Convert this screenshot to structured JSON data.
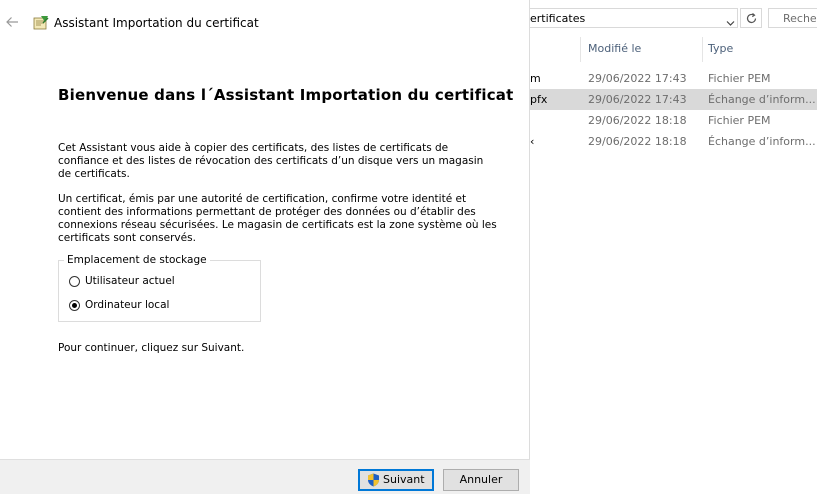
{
  "explorer": {
    "address_text": "ertificates",
    "search_placeholder": "Recher",
    "columns": {
      "modified": "Modifié le",
      "type": "Type"
    },
    "files": [
      {
        "name_fragment": "m",
        "modified": "29/06/2022 17:43",
        "type": "Fichier PEM",
        "selected": false
      },
      {
        "name_fragment": "pfx",
        "modified": "29/06/2022 17:43",
        "type": "Échange d’inform...",
        "selected": true
      },
      {
        "name_fragment": "",
        "modified": "29/06/2022 18:18",
        "type": "Fichier PEM",
        "selected": false
      },
      {
        "name_fragment": "‹",
        "modified": "29/06/2022 18:18",
        "type": "Échange d’inform...",
        "selected": false
      }
    ]
  },
  "wizard": {
    "title": "Assistant Importation du certificat",
    "heading": "Bienvenue dans l´Assistant Importation du certificat",
    "para1": "Cet Assistant vous aide à copier des certificats, des listes de certificats de confiance et des listes de révocation des certificats d’un disque vers un magasin de certificats.",
    "para2": "Un certificat, émis par une autorité de certification, confirme votre identité et contient des informations permettant de protéger des données ou d’établir des connexions réseau sécurisées. Le magasin de certificats est la zone système où les certificats sont conservés.",
    "storage": {
      "legend": "Emplacement de stockage",
      "options": [
        {
          "label": "Utilisateur actuel",
          "checked": false
        },
        {
          "label": "Ordinateur local",
          "checked": true
        }
      ]
    },
    "continue_text": "Pour continuer, cliquez sur Suivant.",
    "buttons": {
      "next": "Suivant",
      "cancel": "Annuler"
    }
  }
}
